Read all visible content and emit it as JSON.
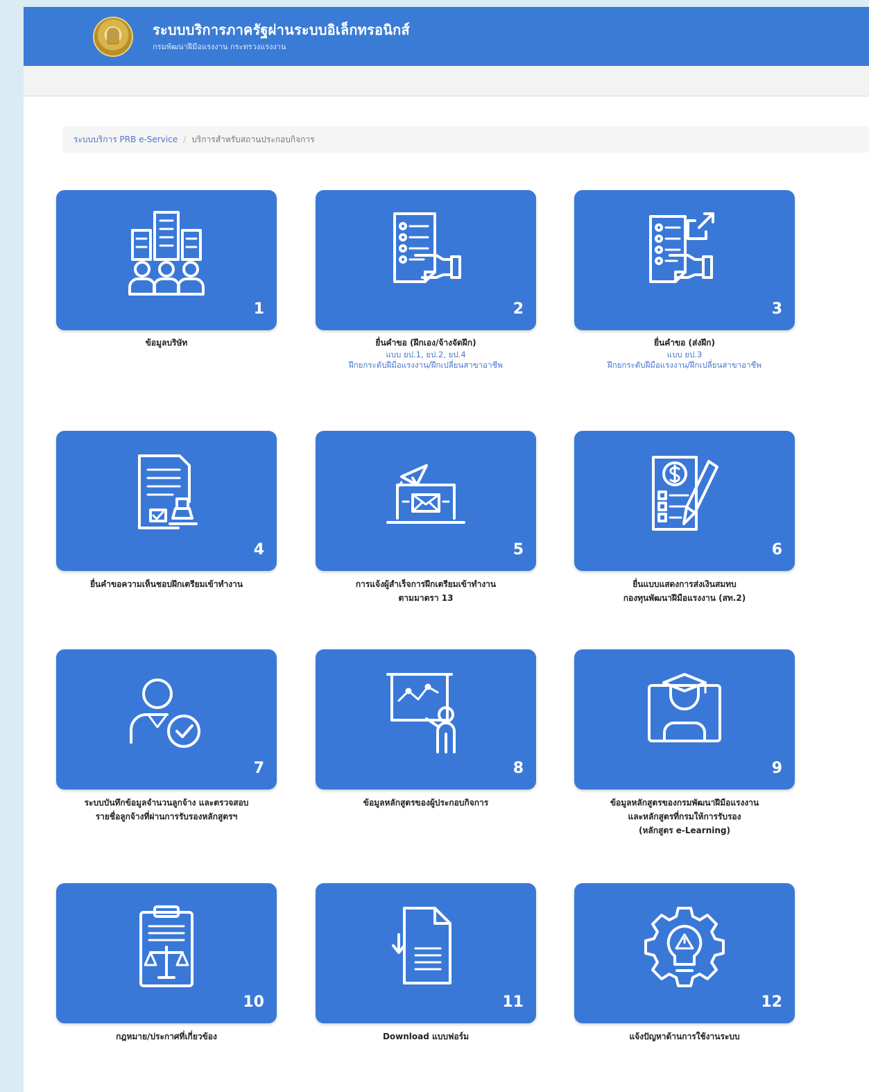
{
  "header": {
    "title": "ระบบบริการภาครัฐผ่านระบบอิเล็กทรอนิกส์",
    "subtitle": "กรมพัฒนาฝีมือแรงงาน กระทรวงแรงงาน"
  },
  "breadcrumb": {
    "home": "ระบบบริการ PRB e-Service",
    "separator": "/",
    "current": "บริการสำหรับสถานประกอบกิจการ"
  },
  "tiles": [
    {
      "number": "1",
      "icon": "company-buildings-icon",
      "label": "ข้อมูลบริษัท",
      "sub1": "",
      "sub2": ""
    },
    {
      "number": "2",
      "icon": "document-handover-icon",
      "label": "ยื่นคำขอ (ฝึกเอง/จ้างจัดฝึก)",
      "sub1": "แบบ ยป.1, ยป.2, ยป.4",
      "sub2": "ฝึกยกระดับฝีมือแรงงาน/ฝึกเปลี่ยนสาขาอาชีพ"
    },
    {
      "number": "3",
      "icon": "document-send-icon",
      "label": "ยื่นคำขอ (ส่งฝึก)",
      "sub1": "แบบ ยป.3",
      "sub2": "ฝึกยกระดับฝีมือแรงงาน/ฝึกเปลี่ยนสาขาอาชีพ"
    },
    {
      "number": "4",
      "icon": "stamped-document-icon",
      "label": "ยื่นคำขอความเห็นชอบฝึกเตรียมเข้าทำงาน",
      "line2": ""
    },
    {
      "number": "5",
      "icon": "email-notification-icon",
      "label": "การแจ้งผู้สำเร็จการฝึกเตรียมเข้าทำงาน",
      "line2": "ตามมาตรา 13"
    },
    {
      "number": "6",
      "icon": "payment-form-icon",
      "label": "ยื่นแบบแสดงการส่งเงินสมทบ",
      "line2": "กองทุนพัฒนาฝีมือแรงงาน (สท.2)"
    },
    {
      "number": "7",
      "icon": "verified-employee-icon",
      "label": "ระบบบันทึกข้อมูลจำนวนลูกจ้าง และตรวจสอบ",
      "line2": "รายชื่อลูกจ้างที่ผ่านการรับรองหลักสูตรฯ",
      "line3": ""
    },
    {
      "number": "8",
      "icon": "presentation-trainer-icon",
      "label": "ข้อมูลหลักสูตรของผู้ประกอบกิจการ",
      "line2": "",
      "line3": ""
    },
    {
      "number": "9",
      "icon": "e-learning-graduate-icon",
      "label": "ข้อมูลหลักสูตรของกรมพัฒนาฝีมือแรงงาน",
      "line2": "และหลักสูตรที่กรมให้การรับรอง",
      "line3": "(หลักสูตร e-Learning)"
    },
    {
      "number": "10",
      "icon": "law-clipboard-icon",
      "label": "กฎหมาย/ประกาศที่เกี่ยวข้อง"
    },
    {
      "number": "11",
      "icon": "download-form-icon",
      "label": "Download แบบฟอร์ม"
    },
    {
      "number": "12",
      "icon": "problem-report-icon",
      "label": "แจ้งปัญหาด้านการใช้งานระบบ"
    }
  ]
}
